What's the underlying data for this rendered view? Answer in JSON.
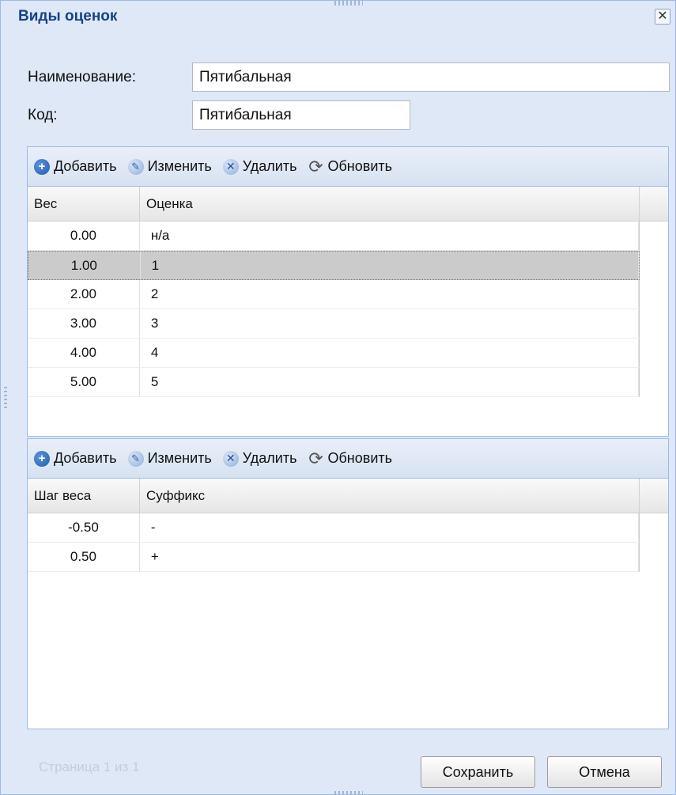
{
  "window": {
    "title": "Виды оценок",
    "close_glyph": "✕"
  },
  "form": {
    "name_label": "Наименование:",
    "name_value": "Пятибальная",
    "code_label": "Код:",
    "code_value": "Пятибальная"
  },
  "toolbar": {
    "add_label": "Добавить",
    "edit_label": "Изменить",
    "delete_label": "Удалить",
    "refresh_label": "Обновить"
  },
  "grades_grid": {
    "columns": [
      "Вес",
      "Оценка"
    ],
    "rows": [
      {
        "weight": "0.00",
        "grade": "н/а",
        "selected": false
      },
      {
        "weight": "1.00",
        "grade": "1",
        "selected": true
      },
      {
        "weight": "2.00",
        "grade": "2",
        "selected": false
      },
      {
        "weight": "3.00",
        "grade": "3",
        "selected": false
      },
      {
        "weight": "4.00",
        "grade": "4",
        "selected": false
      },
      {
        "weight": "5.00",
        "grade": "5",
        "selected": false
      }
    ]
  },
  "suffix_grid": {
    "columns": [
      "Шаг веса",
      "Суффикс"
    ],
    "rows": [
      {
        "step": "-0.50",
        "suffix": "-"
      },
      {
        "step": "0.50",
        "suffix": "+"
      }
    ]
  },
  "paging": {
    "text": "Страница 1 из 1"
  },
  "footer": {
    "save_label": "Сохранить",
    "cancel_label": "Отмена"
  }
}
